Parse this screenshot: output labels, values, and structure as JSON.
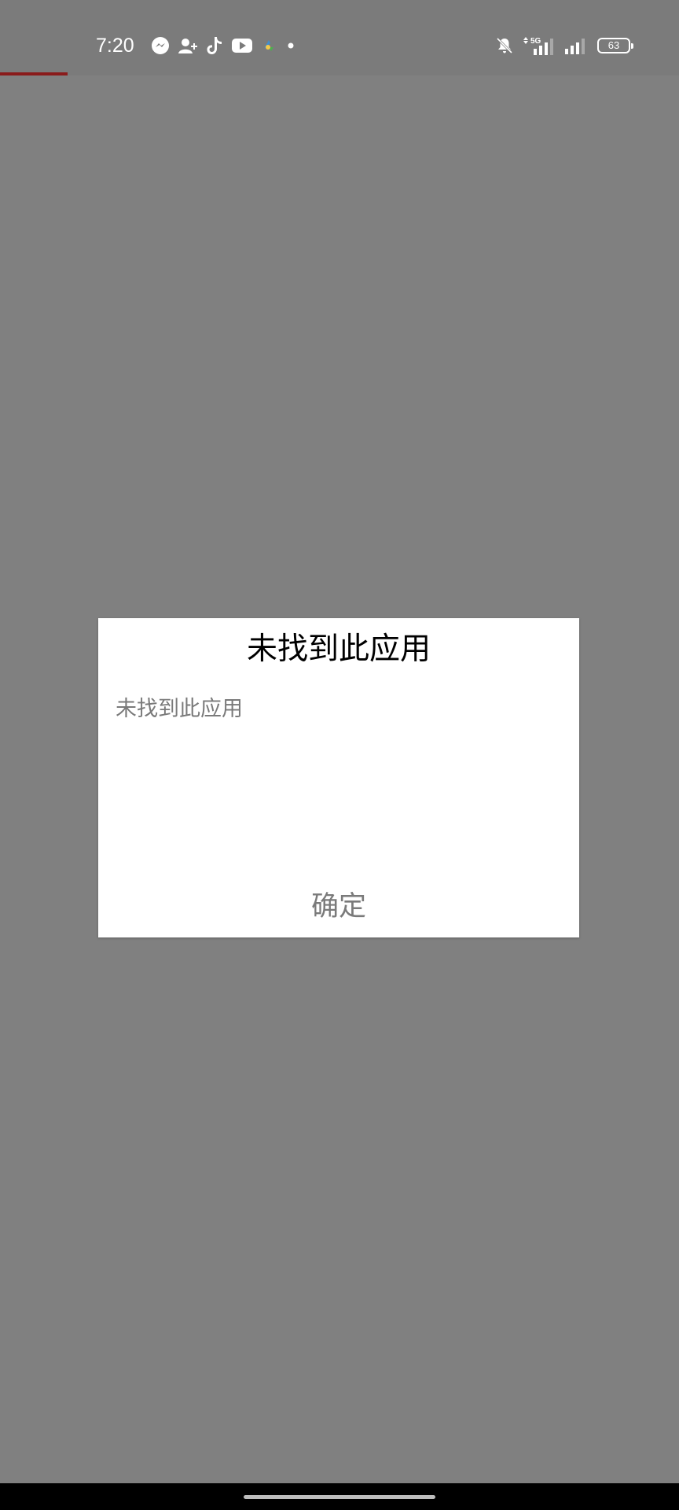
{
  "status_bar": {
    "time": "7:20",
    "left_icons": [
      "messenger-icon",
      "add-contact-icon",
      "tiktok-icon",
      "youtube-icon",
      "app-icon",
      "dot-icon"
    ],
    "right_icons": [
      "bell-muted-icon",
      "5g-signal-icon",
      "signal-icon",
      "battery-icon"
    ],
    "network_label": "5G",
    "battery_level": "63"
  },
  "page_progress": {
    "value": 0.1,
    "color": "#8a1b1b"
  },
  "dialog": {
    "title": "未找到此应用",
    "message": "未找到此应用",
    "confirm_label": "确定"
  },
  "colors": {
    "scrim": "#808080",
    "dialog_bg": "#ffffff",
    "muted_text": "#7a7a7a"
  }
}
